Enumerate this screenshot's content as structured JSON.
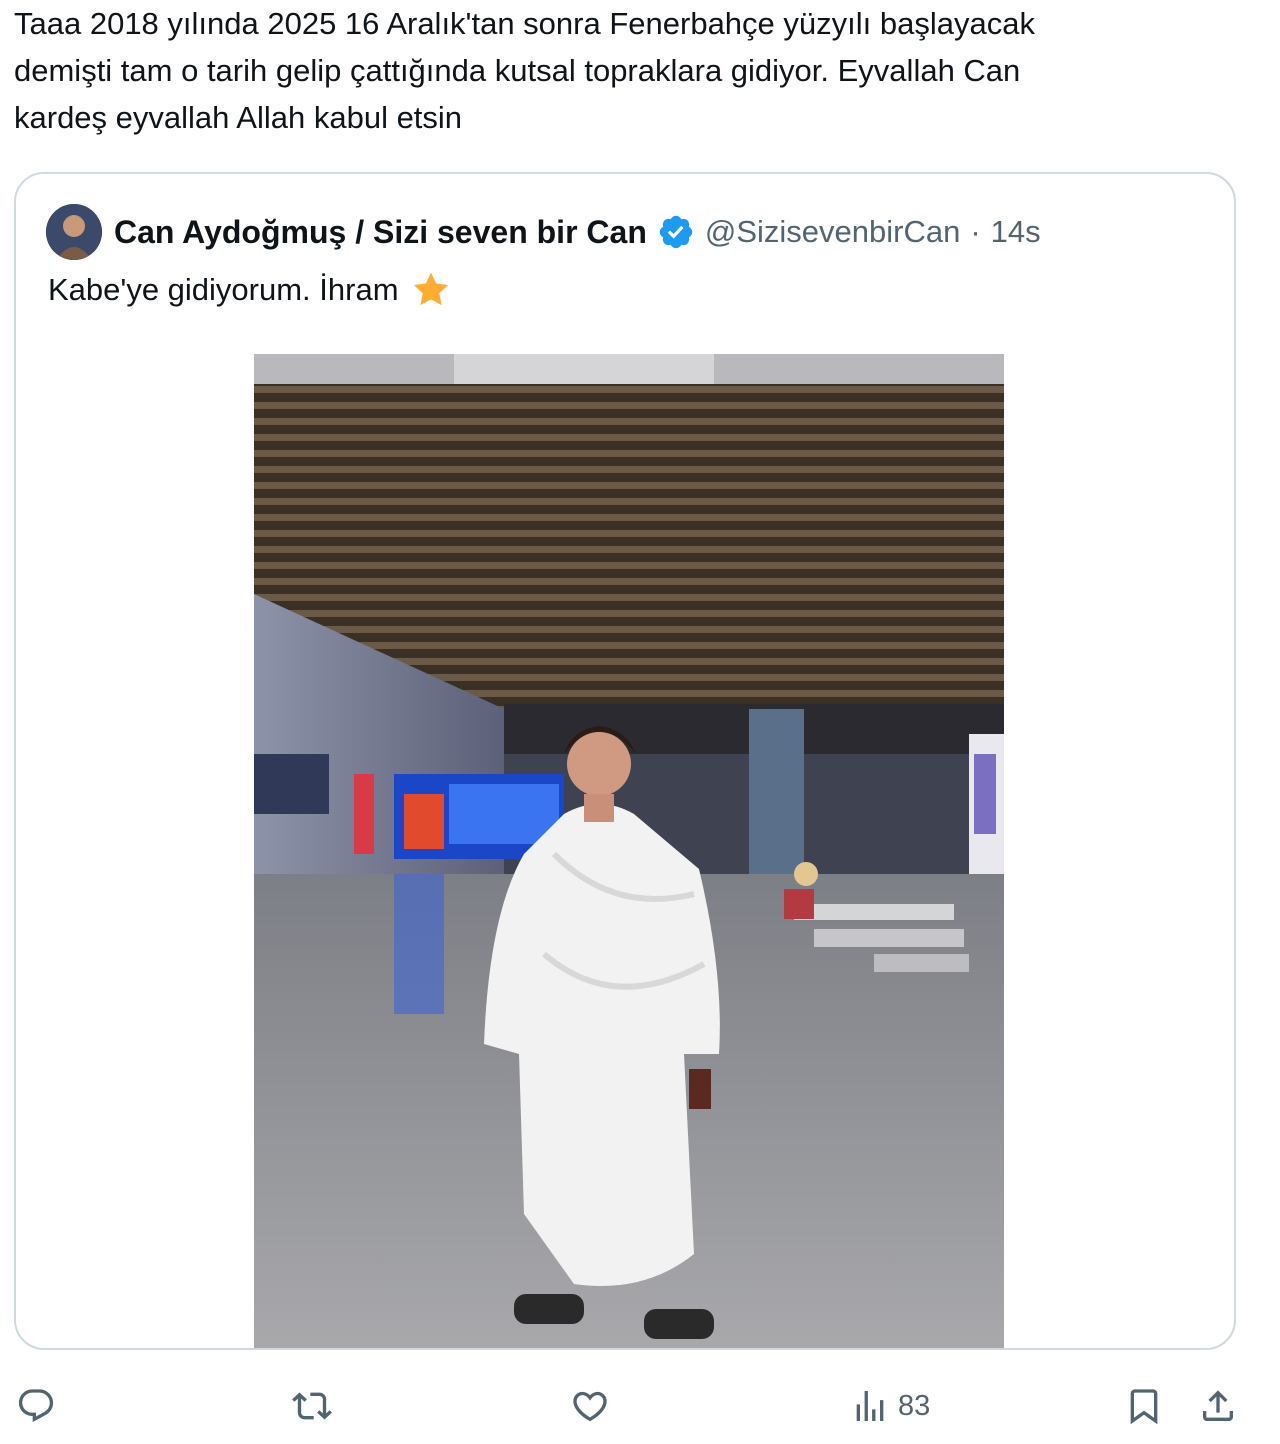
{
  "tweet": {
    "text": "Taaa 2018 yılında 2025 16 Aralık'tan sonra Fenerbahçe yüzyılı başlayacak\ndemişti tam o tarih gelip çattığında kutsal topraklara gidiyor. Eyvallah Can\nkardeş eyvallah Allah kabul etsin"
  },
  "quote": {
    "display_name": "Can Aydoğmuş / Sizi seven bir Can",
    "handle": "@SizisevenbirCan",
    "separator": "·",
    "time": "14s",
    "text": "Kabe'ye gidiyorum. İhram",
    "emoji": "star-emoji",
    "verified_color": "#1d9bf0"
  },
  "actions": {
    "reply_icon": "reply-icon",
    "retweet_icon": "retweet-icon",
    "like_icon": "heart-icon",
    "views_icon": "views-icon",
    "views_count": "83",
    "bookmark_icon": "bookmark-icon",
    "share_icon": "share-icon"
  },
  "colors": {
    "text": "#0f1419",
    "secondary": "#536471",
    "border": "#cfd9de",
    "accent": "#1d9bf0"
  }
}
